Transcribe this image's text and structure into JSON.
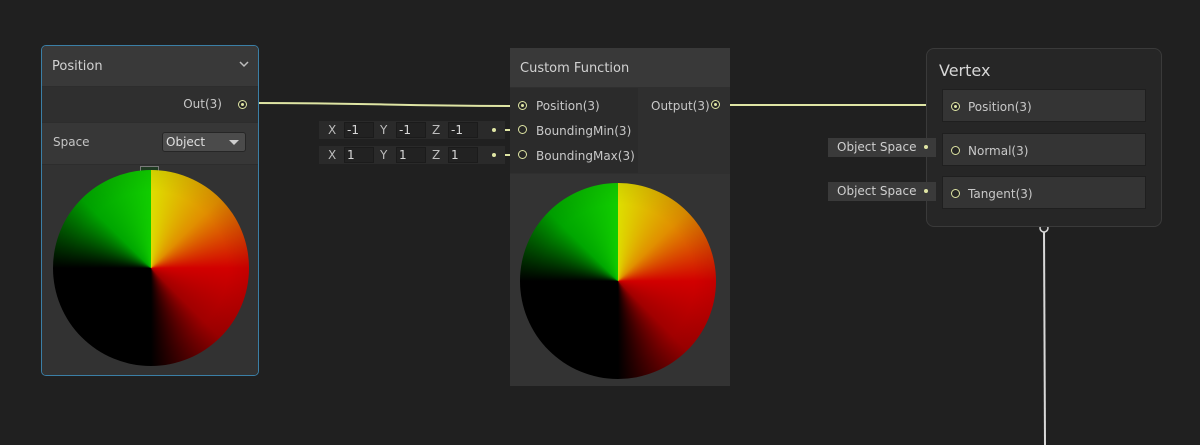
{
  "position_node": {
    "title": "Position",
    "output_label": "Out(3)",
    "space_label": "Space",
    "space_value": "Object"
  },
  "custom_function_node": {
    "title": "Custom Function",
    "inputs": [
      "Position(3)",
      "BoundingMin(3)",
      "BoundingMax(3)"
    ],
    "output_label": "Output(3)"
  },
  "bounding_min": {
    "x_label": "X",
    "x_value": "-1",
    "y_label": "Y",
    "y_value": "-1",
    "z_label": "Z",
    "z_value": "-1"
  },
  "bounding_max": {
    "x_label": "X",
    "x_value": "1",
    "y_label": "Y",
    "y_value": "1",
    "z_label": "Z",
    "z_value": "1"
  },
  "vertex_node": {
    "title": "Vertex",
    "ports": [
      "Position(3)",
      "Normal(3)",
      "Tangent(3)"
    ],
    "normal_space": "Object Space",
    "tangent_space": "Object Space"
  },
  "colors": {
    "wire": "#dfe5a4",
    "selection_border": "#3b7fa6",
    "background": "#202020"
  }
}
